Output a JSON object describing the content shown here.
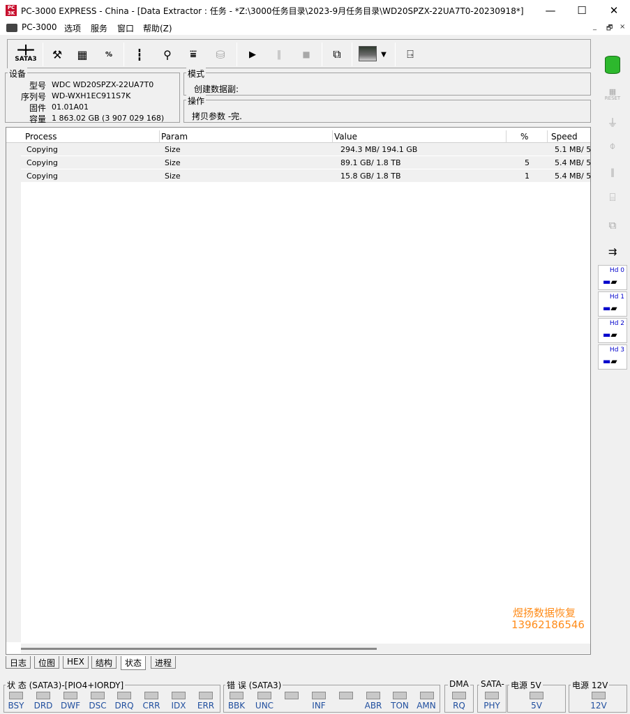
{
  "window": {
    "title": "PC-3000 EXPRESS - China - [Data Extractor : 任务 - *Z:\\3000任务目录\\2023-9月任务目录\\WD20SPZX-22UA7T0-20230918*]",
    "app_icon_text": "PC\n3K",
    "minimize": "—",
    "maximize": "☐",
    "close": "✕"
  },
  "menu": {
    "app": "PC-3000",
    "items": [
      "选项",
      "服务",
      "窗口",
      "帮助(Z)"
    ],
    "mdi_controls": [
      "_",
      "🗗",
      "×"
    ]
  },
  "toolbar": {
    "sata_label": "SATA3",
    "buttons": [
      "sata-icon",
      "tools-icon",
      "chip-icon",
      "percent-icon",
      "tree-icon",
      "binoculars-icon",
      "scan-icon",
      "db-icon",
      "play-icon",
      "pause-icon",
      "stop-icon",
      "copy-icon",
      "image-icon",
      "dropdown-icon",
      "exit-icon"
    ]
  },
  "device": {
    "legend": "设备",
    "model_label": "型号",
    "model_value": "WDC WD20SPZX-22UA7T0",
    "serial_label": "序列号",
    "serial_value": "WD-WXH1EC911S7K",
    "firmware_label": "固件",
    "firmware_value": "01.01A01",
    "capacity_label": "容量",
    "capacity_value": "1 863.02 GB (3 907 029 168)"
  },
  "mode": {
    "legend": "模式",
    "value": "创建数据副:"
  },
  "operation": {
    "legend": "操作",
    "value": "拷贝参数 -完."
  },
  "table": {
    "columns": [
      "Process",
      "Param",
      "Value",
      "%",
      "Speed"
    ],
    "rows": [
      {
        "process": "Copying",
        "param": "Size",
        "value": "294.3 MB/ 194.1 GB",
        "percent": "",
        "speed": "5.1 MB/ 5"
      },
      {
        "process": "Copying",
        "param": "Size",
        "value": "89.1 GB/ 1.8 TB",
        "percent": "5",
        "speed": "5.4 MB/ 5"
      },
      {
        "process": "Copying",
        "param": "Size",
        "value": "15.8 GB/ 1.8 TB",
        "percent": "1",
        "speed": "5.4 MB/ 5"
      }
    ]
  },
  "watermark": {
    "line1": "煜扬数据恢复",
    "line2": "13962186546"
  },
  "tabs": [
    "日志",
    "位图",
    "HEX",
    "结构",
    "状态",
    "进程"
  ],
  "active_tab": "状态",
  "status": {
    "state_title": "状 态 (SATA3)-[PIO4+IORDY]",
    "state_leds": [
      "BSY",
      "DRD",
      "DWF",
      "DSC",
      "DRQ",
      "CRR",
      "IDX",
      "ERR"
    ],
    "error_title": "错 误 (SATA3)",
    "error_leds": [
      "BBK",
      "UNC",
      "",
      "INF",
      "",
      "ABR",
      "TON",
      "AMN"
    ],
    "dma_title": "DMA",
    "dma_leds": [
      "RQ"
    ],
    "sata_title": "SATA-",
    "sata_leds": [
      "PHY"
    ],
    "p5v_title": "电源 5V",
    "p5v_leds": [
      "5V"
    ],
    "p12v_title": "电源 12V",
    "p12v_leds": [
      "12V"
    ]
  },
  "right_panel": {
    "buttons": [
      "database-icon",
      "reset-icon",
      "power-icon",
      "head-icon",
      "pause-icon",
      "chip-reset-icon",
      "copy-x-icon",
      "sata-plug-icon"
    ],
    "reset_label": "RESET",
    "heads": [
      "Hd 0",
      "Hd 1",
      "Hd 2",
      "Hd 3"
    ]
  },
  "colors": {
    "watermark": "#ff8c1a",
    "led_label": "#1f4e9e",
    "head_label": "#0000cc"
  }
}
